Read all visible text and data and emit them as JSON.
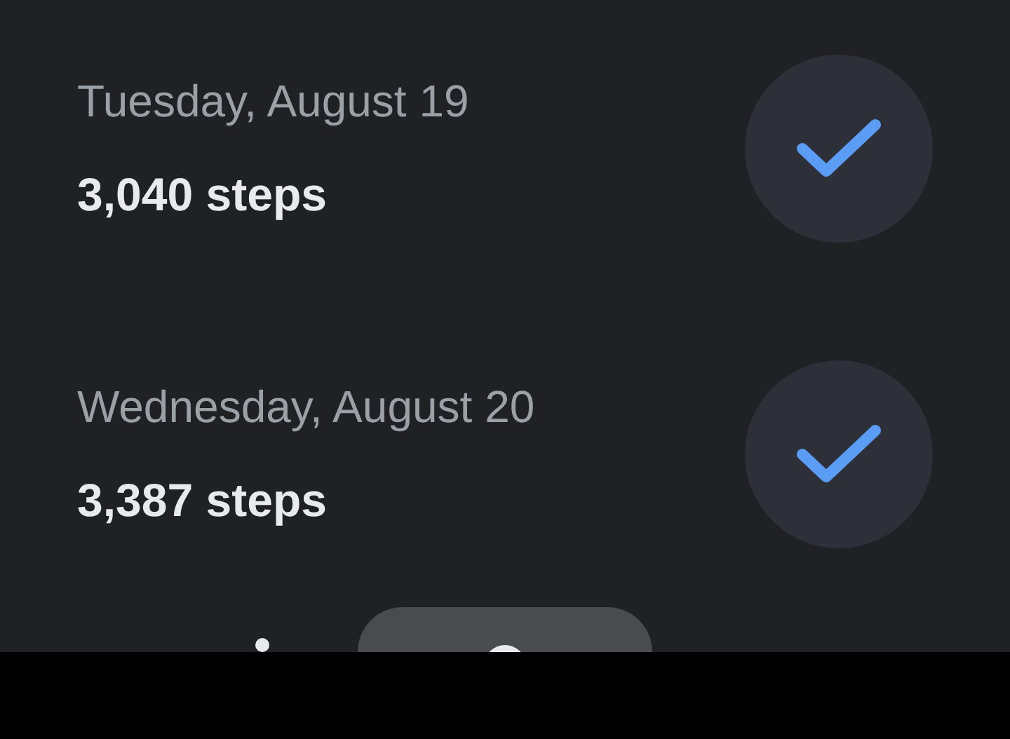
{
  "days": [
    {
      "date": "Tuesday, August 19",
      "steps": "3,040 steps",
      "completed": true
    },
    {
      "date": "Wednesday, August 20",
      "steps": "3,387 steps",
      "completed": true
    }
  ],
  "bottom_nav": {
    "items": [
      {
        "selected": false
      },
      {
        "selected": true
      }
    ]
  }
}
